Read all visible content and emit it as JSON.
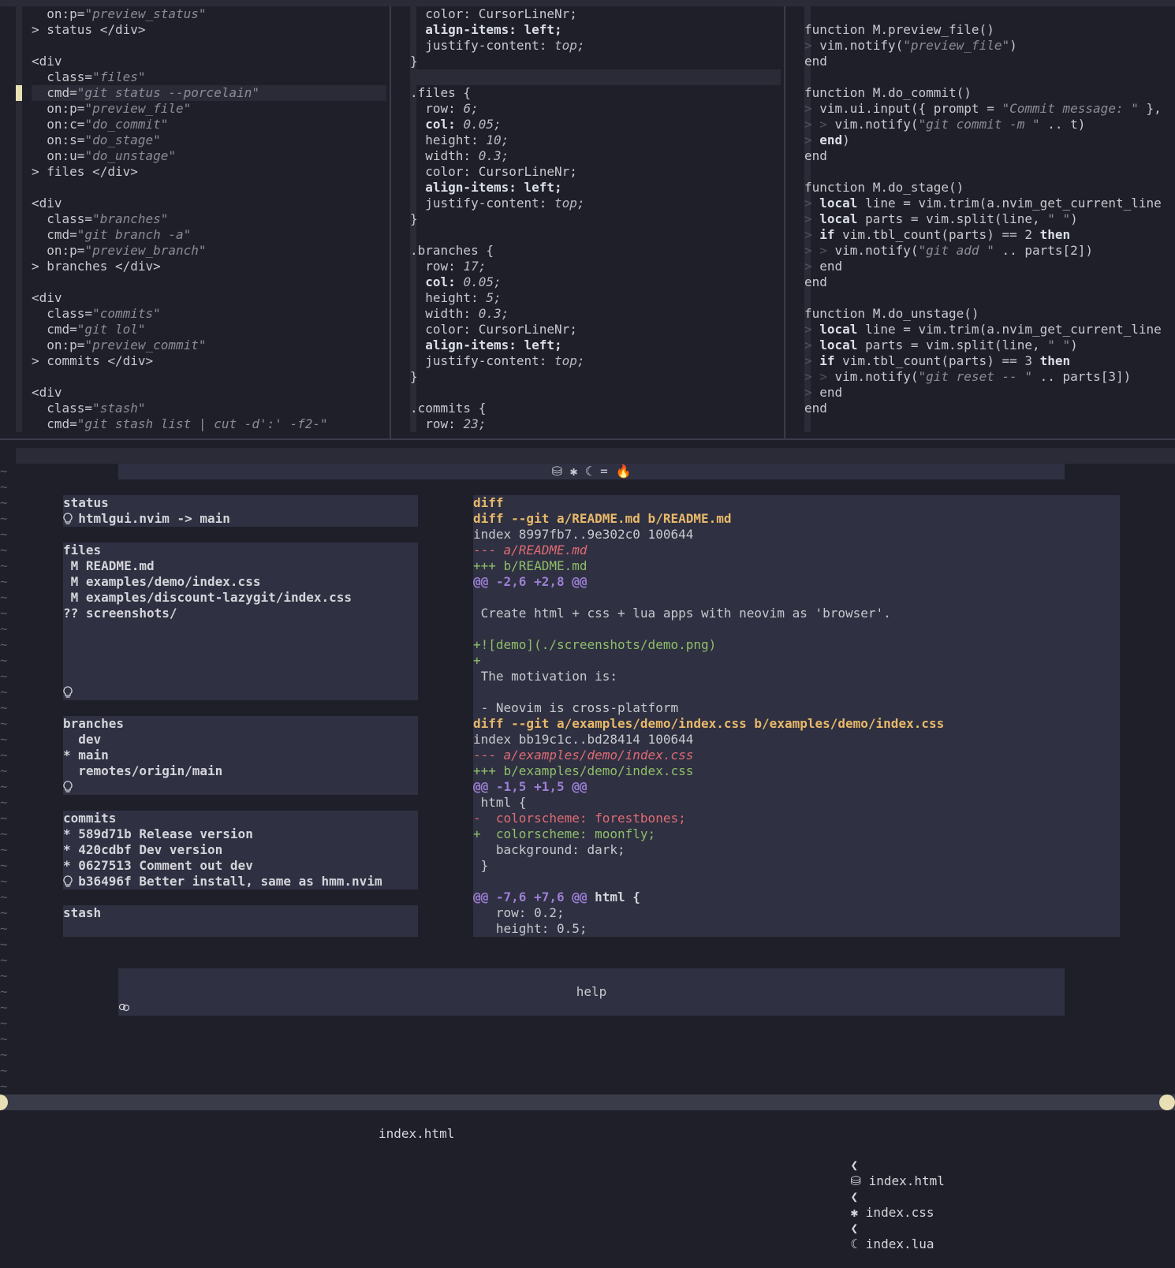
{
  "html_pane": {
    "lines": [
      [
        "  on:p=",
        "\"preview_status\""
      ],
      [
        "> status </div>",
        ""
      ],
      [
        "",
        ""
      ],
      [
        "<div",
        ""
      ],
      [
        "  class=",
        "\"files\""
      ],
      [
        "  cmd=",
        "\"git status --porcelain\""
      ],
      [
        "  on:p=",
        "\"preview_file\""
      ],
      [
        "  on:c=",
        "\"do_commit\""
      ],
      [
        "  on:s=",
        "\"do_stage\""
      ],
      [
        "  on:u=",
        "\"do_unstage\""
      ],
      [
        "> files </div>",
        ""
      ],
      [
        "",
        ""
      ],
      [
        "<div",
        ""
      ],
      [
        "  class=",
        "\"branches\""
      ],
      [
        "  cmd=",
        "\"git branch -a\""
      ],
      [
        "  on:p=",
        "\"preview_branch\""
      ],
      [
        "> branches </div>",
        ""
      ],
      [
        "",
        ""
      ],
      [
        "<div",
        ""
      ],
      [
        "  class=",
        "\"commits\""
      ],
      [
        "  cmd=",
        "\"git lol\""
      ],
      [
        "  on:p=",
        "\"preview_commit\""
      ],
      [
        "> commits </div>",
        ""
      ],
      [
        "",
        ""
      ],
      [
        "<div",
        ""
      ],
      [
        "  class=",
        "\"stash\""
      ],
      [
        "  cmd=",
        "\"git stash list | cut -d':' -f2-\""
      ]
    ]
  },
  "css_pane": {
    "lines": [
      [
        "  color: ",
        "CursorLineNr;"
      ],
      [
        "  align-items: ",
        "left;"
      ],
      [
        "  justify-content: ",
        "top;"
      ],
      [
        "}",
        ""
      ],
      [
        "",
        ""
      ],
      [
        ".files {",
        ""
      ],
      [
        "  row: ",
        "6;"
      ],
      [
        "  col: ",
        "0.05;"
      ],
      [
        "  height: ",
        "10;"
      ],
      [
        "  width: ",
        "0.3;"
      ],
      [
        "  color: ",
        "CursorLineNr;"
      ],
      [
        "  align-items: ",
        "left;"
      ],
      [
        "  justify-content: ",
        "top;"
      ],
      [
        "}",
        ""
      ],
      [
        "",
        ""
      ],
      [
        ".branches {",
        ""
      ],
      [
        "  row: ",
        "17;"
      ],
      [
        "  col: ",
        "0.05;"
      ],
      [
        "  height: ",
        "5;"
      ],
      [
        "  width: ",
        "0.3;"
      ],
      [
        "  color: ",
        "CursorLineNr;"
      ],
      [
        "  align-items: ",
        "left;"
      ],
      [
        "  justify-content: ",
        "top;"
      ],
      [
        "}",
        ""
      ],
      [
        "",
        ""
      ],
      [
        ".commits {",
        ""
      ],
      [
        "  row: ",
        "23;"
      ]
    ]
  },
  "lua_pane": {
    "lines": [
      "",
      "function M.preview_file()",
      "> vim.notify(\"preview_file\")",
      "end",
      "",
      "function M.do_commit()",
      "> vim.ui.input({ prompt = \"Commit message: \" },",
      "> > vim.notify(\"git commit -m \" .. t)",
      "> end)",
      "end",
      "",
      "function M.do_stage()",
      "> local line = vim.trim(a.nvim_get_current_line",
      "> local parts = vim.split(line, \" \")",
      "> if vim.tbl_count(parts) == 2 then",
      "> > vim.notify(\"git add \" .. parts[2])",
      "> end",
      "end",
      "",
      "function M.do_unstage()",
      "> local line = vim.trim(a.nvim_get_current_line",
      "> local parts = vim.split(line, \" \")",
      "> if vim.tbl_count(parts) == 3 then",
      "> > vim.notify(\"git reset -- \" .. parts[3])",
      "> end",
      "end"
    ]
  },
  "app": {
    "header_title": "⛁ ✱ ☾ = 🔥",
    "status_box": {
      "title": "status",
      "line": "  htmlgui.nvim -> main"
    },
    "files_box": {
      "title": "files",
      "items": [
        " M README.md",
        " M examples/demo/index.css",
        " M examples/discount-lazygit/index.css",
        "?? screenshots/"
      ]
    },
    "branches_box": {
      "title": "branches",
      "items": [
        "  dev",
        "* main",
        "  remotes/origin/main"
      ]
    },
    "commits_box": {
      "title": "commits",
      "items": [
        "* 589d71b Release version",
        "* 420cdbf Dev version",
        "* 0627513 Comment out dev",
        "  b36496f Better install, same as hmm.nvim"
      ]
    },
    "stash_box": {
      "title": "stash"
    },
    "diff_box": {
      "lines": [
        [
          "h",
          "diff"
        ],
        [
          "h",
          "diff --git a/README.md b/README.md"
        ],
        [
          "n",
          "index 8997fb7..9e302c0 100644"
        ],
        [
          "di",
          "--- a/README.md"
        ],
        [
          "a",
          "+++ b/README.md"
        ],
        [
          "k",
          "@@ -2,6 +2,8 @@"
        ],
        [
          "n",
          ""
        ],
        [
          "n",
          " Create html + css + lua apps with neovim as 'browser'."
        ],
        [
          "n",
          ""
        ],
        [
          "a",
          "+![demo](./screenshots/demo.png)"
        ],
        [
          "a",
          "+"
        ],
        [
          "n",
          " The motivation is:"
        ],
        [
          "n",
          ""
        ],
        [
          "n",
          " - Neovim is cross-platform"
        ],
        [
          "h",
          "diff --git a/examples/demo/index.css b/examples/demo/index.css"
        ],
        [
          "n",
          "index bb19c1c..bd28414 100644"
        ],
        [
          "di",
          "--- a/examples/demo/index.css"
        ],
        [
          "a",
          "+++ b/examples/demo/index.css"
        ],
        [
          "k",
          "@@ -1,5 +1,5 @@"
        ],
        [
          "n",
          " html {"
        ],
        [
          "d",
          "-  colorscheme: forestbones;"
        ],
        [
          "a",
          "+  colorscheme: moonfly;"
        ],
        [
          "n",
          "   background: dark;"
        ],
        [
          "n",
          " }"
        ],
        [
          "n",
          ""
        ],
        [
          "k2",
          "@@ -7,6 +7,6 @@ html {"
        ],
        [
          "n",
          "   row: 0.2;"
        ],
        [
          "n",
          "   height: 0.5;"
        ]
      ]
    },
    "help_label": "help"
  },
  "statusline": {
    "center": "index.html",
    "tabs": [
      "⛁ index.html",
      "✱ index.css",
      "☾ index.lua"
    ],
    "separator": "❮"
  },
  "colors": {
    "background": "#1e1f29",
    "panel": "#2f3041",
    "diff_header": "#e8b96a",
    "diff_hunk": "#9c7fd6",
    "diff_add": "#8fbf6a",
    "diff_del": "#e06c75",
    "cursor": "#e9dfb5"
  }
}
